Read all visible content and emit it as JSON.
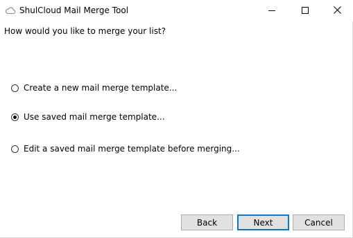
{
  "window": {
    "title": "ShulCloud Mail Merge Tool",
    "app_icon": "cloud-icon",
    "controls": {
      "minimize_icon": "minimize-icon",
      "maximize_icon": "maximize-icon",
      "close_icon": "close-icon"
    }
  },
  "prompt": "How would you like to merge your list?",
  "options": [
    {
      "label": "Create a new mail merge template...",
      "checked": false
    },
    {
      "label": "Use saved mail merge template...",
      "checked": true
    },
    {
      "label": "Edit a saved mail merge template before merging...",
      "checked": false
    }
  ],
  "buttons": {
    "back": "Back",
    "next": "Next",
    "cancel": "Cancel"
  },
  "colors": {
    "accent": "#0078d7",
    "button_face": "#e1e1e1",
    "button_border": "#adadad"
  }
}
